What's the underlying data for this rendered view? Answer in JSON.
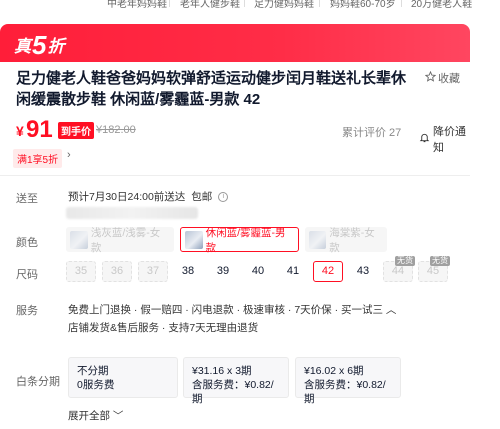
{
  "top_tags": [
    "中老年妈妈鞋",
    "老年人健步鞋",
    "足力健妈妈鞋",
    "妈妈鞋60-70岁",
    "20万健老人鞋"
  ],
  "banner": {
    "text_prefix": "真",
    "text_big": "5",
    "text_suffix": "折"
  },
  "product": {
    "title": "足力健老人鞋爸爸妈妈软弹舒适运动健步闰月鞋送礼长辈休闲缓震散步鞋 休闲蓝/雾霾蓝-男款 42",
    "favorite_label": "收藏"
  },
  "price": {
    "symbol": "¥",
    "value": "91",
    "tag": "到手价",
    "original": "¥182.00",
    "review_text": "累计评价 27",
    "notify_label": "降价通知"
  },
  "promo": {
    "label": "满1享5折",
    "arrow": "›"
  },
  "shipping": {
    "label": "送至",
    "text": "预计7月30日24:00前送达",
    "free_ship": "包邮",
    "info_icon": "i"
  },
  "color": {
    "label": "颜色",
    "options": [
      {
        "text": "浅灰蓝/浅雾-女款",
        "state": "disabled"
      },
      {
        "text": "休闲蓝/雾霾蓝-男款",
        "state": "selected"
      },
      {
        "text": "海棠紫-女款",
        "state": "disabled"
      }
    ]
  },
  "size": {
    "label": "尺码",
    "options": [
      {
        "text": "35",
        "state": "disabled"
      },
      {
        "text": "36",
        "state": "disabled"
      },
      {
        "text": "37",
        "state": "disabled"
      },
      {
        "text": "38",
        "state": "available"
      },
      {
        "text": "39",
        "state": "available"
      },
      {
        "text": "40",
        "state": "available"
      },
      {
        "text": "41",
        "state": "available"
      },
      {
        "text": "42",
        "state": "selected"
      },
      {
        "text": "43",
        "state": "available"
      },
      {
        "text": "44",
        "state": "nostock"
      },
      {
        "text": "45",
        "state": "nostock"
      }
    ],
    "nostock_label": "无货"
  },
  "service": {
    "label": "服务",
    "line1": "免费上门退换 · 假一赔四 · 闪电退款 · 极速审核 · 7天价保 · 买一试三 ︿",
    "line2": "店铺发货&售后服务 · 支持7天无理由退货"
  },
  "installment": {
    "label": "白条分期",
    "plans": [
      {
        "line1": "不分期",
        "line2": "0服务费"
      },
      {
        "line1": "¥31.16 x 3期",
        "line2": "含服务费：¥0.82/期"
      },
      {
        "line1": "¥16.02 x 6期",
        "line2": "含服务费：¥0.82/期"
      }
    ],
    "expand_label": "展开全部 ﹀"
  },
  "colors": {
    "accent": "#ff0f23",
    "banner": "#ff2d47"
  }
}
